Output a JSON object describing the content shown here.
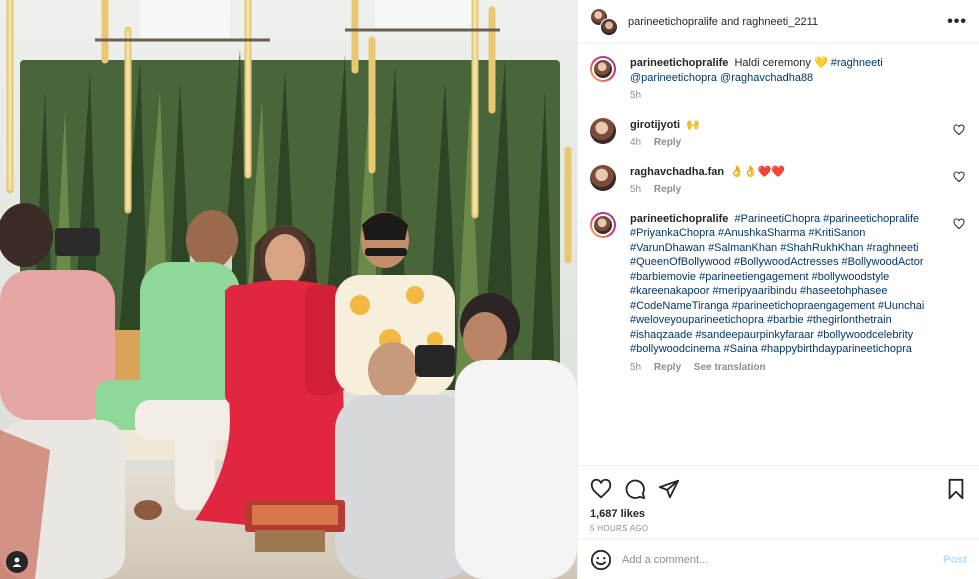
{
  "header": {
    "names": "parineetichopralife and raghneeti_2211",
    "more_label": "•••"
  },
  "caption": {
    "user": "parineetichopralife",
    "text": "Haldi ceremony 💛",
    "tags": "#raghneeti @parineetichopra @raghavchadha88",
    "time": "5h"
  },
  "comments": [
    {
      "user": "girotijyoti",
      "text": "🙌",
      "time": "4h",
      "reply": "Reply"
    },
    {
      "user": "raghavchadha.fan",
      "text": "👌👌❤️❤️",
      "time": "5h",
      "reply": "Reply"
    },
    {
      "user": "parineetichopralife",
      "text": "#ParineetiChopra #parineetichopralife #PriyankaChopra #AnushkaSharma #KritiSanon #VarunDhawan #SalmanKhan #ShahRukhKhan #raghneeti #QueenOfBollywood #BollywoodActresses #BollywoodActor #barbiemovie #parineetiengagement #bollywoodstyle #kareenakapoor #meripyaaribindu #haseetohphasee #CodeNameTiranga #parineetichopraengagement #Uunchai #weloveyouparineetichopra #barbie #thegirlonthetrain #ishaqzaade #sandeepaurpinkyfaraar #bollywoodcelebrity #bollywoodcinema #Saina #happybirthdayparineetichopra",
      "time": "5h",
      "reply": "Reply",
      "translate": "See translation"
    }
  ],
  "stats": {
    "likes": "1,687 likes",
    "time_ago": "5 HOURS AGO"
  },
  "add_comment": {
    "placeholder": "Add a comment...",
    "post_label": "Post"
  },
  "icons": {
    "more": "more-dots-icon",
    "like": "heart-icon",
    "comment": "comment-bubble-icon",
    "share": "paper-plane-icon",
    "save": "bookmark-icon",
    "emoji": "emoji-smile-icon",
    "tagged": "user-tag-icon"
  }
}
